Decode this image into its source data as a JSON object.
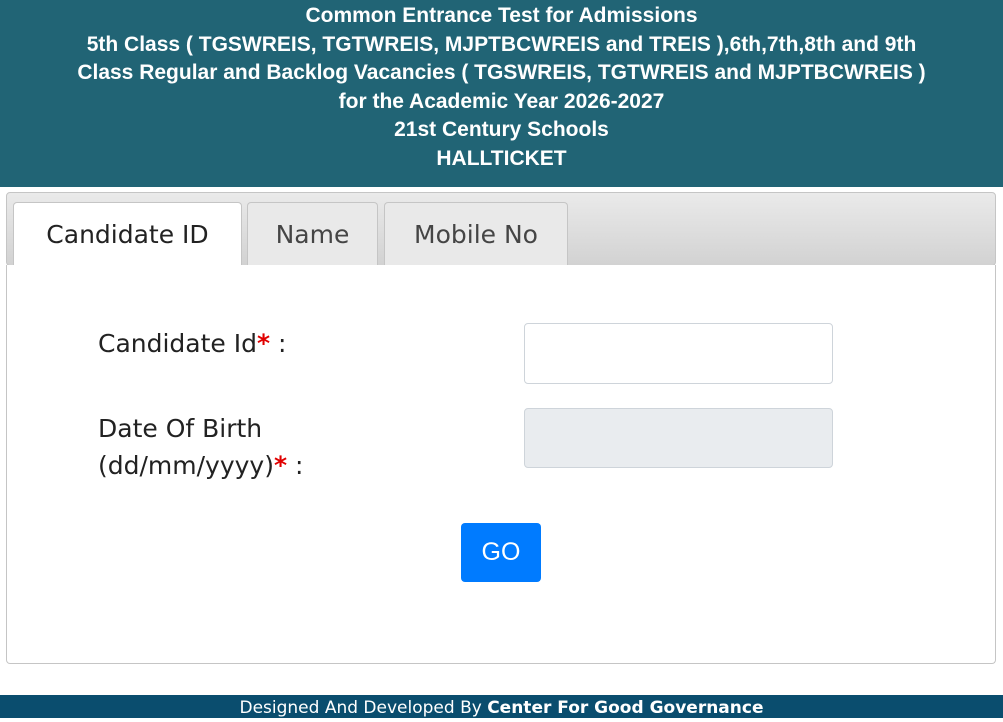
{
  "header": {
    "lines": [
      "Common Entrance Test for Admissions",
      "5th Class ( TGSWREIS, TGTWREIS, MJPTBCWREIS and TREIS ),6th,7th,8th and 9th",
      "Class Regular and Backlog Vacancies ( TGSWREIS, TGTWREIS and MJPTBCWREIS )",
      "for the Academic Year 2026-2027",
      "21st Century Schools",
      "HALLTICKET"
    ]
  },
  "tabs": [
    {
      "label": "Candidate ID",
      "active": true
    },
    {
      "label": "Name",
      "active": false
    },
    {
      "label": "Mobile No",
      "active": false
    }
  ],
  "form": {
    "candidate_id_label": "Candidate Id",
    "dob_label_line1": "Date Of Birth",
    "dob_label_line2": "(dd/mm/yyyy)",
    "required_marker": "*",
    "colon": ":",
    "candidate_id_value": "",
    "dob_value": "",
    "go_label": "GO"
  },
  "footer": {
    "prefix": "Designed And Developed By",
    "org": "Center For Good Governance"
  },
  "colors": {
    "header_bg": "#216475",
    "go_button": "#007bff",
    "required": "#e00000",
    "footer_bg": "#0a4d6e"
  }
}
